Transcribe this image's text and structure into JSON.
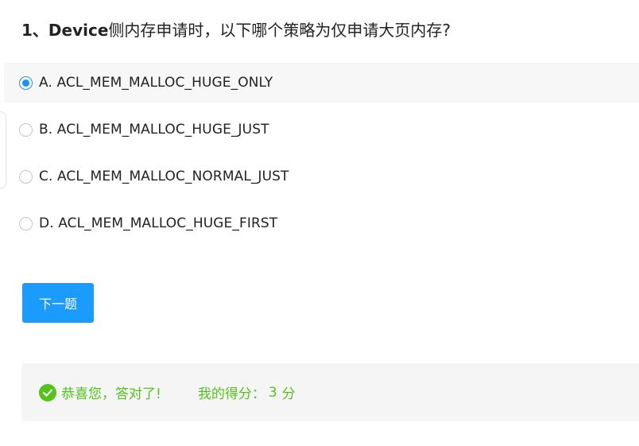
{
  "question": {
    "number": "1、",
    "keyword": "Device",
    "text": "侧内存申请时，以下哪个策略为仅申请大页内存?"
  },
  "options": [
    {
      "label": "A. ACL_MEM_MALLOC_HUGE_ONLY",
      "selected": true
    },
    {
      "label": "B. ACL_MEM_MALLOC_HUGE_JUST",
      "selected": false
    },
    {
      "label": "C. ACL_MEM_MALLOC_NORMAL_JUST",
      "selected": false
    },
    {
      "label": "D. ACL_MEM_MALLOC_HUGE_FIRST",
      "selected": false
    }
  ],
  "next_button": {
    "label": "下一题"
  },
  "result": {
    "icon": "check-circle-icon",
    "message": "恭喜您，答对了!",
    "score_label": "我的得分：",
    "score_value": "3",
    "score_unit": "分"
  },
  "colors": {
    "accent": "#1890ff",
    "button": "#1c9bff",
    "success": "#52c41a",
    "selected_bg": "#f7f7f7",
    "result_bg": "#f5f5f5"
  }
}
